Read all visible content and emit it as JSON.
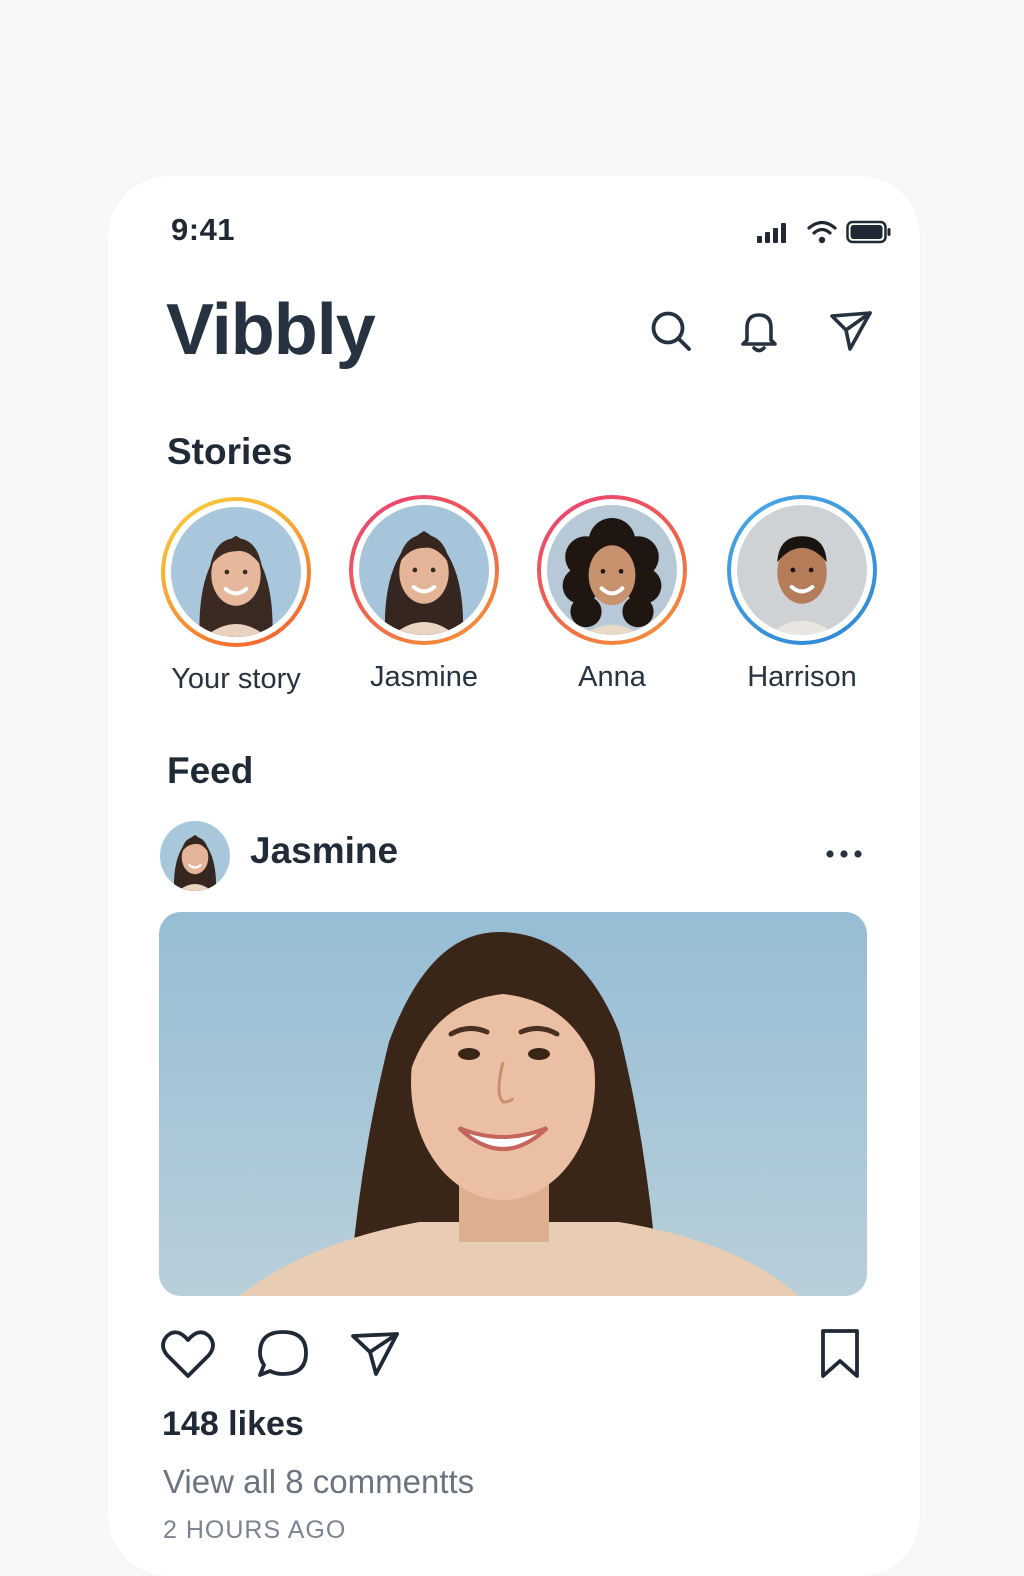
{
  "status_bar": {
    "time": "9:41",
    "signal_icon": "cellular-signal-icon",
    "wifi_icon": "wifi-icon",
    "battery_icon": "battery-icon"
  },
  "header": {
    "app_name": "Vibbly",
    "icons": [
      "search-icon",
      "bell-icon",
      "send-icon"
    ]
  },
  "stories": {
    "title": "Stories",
    "items": [
      {
        "label": "Your story",
        "ring": "gradient-orange-yellow"
      },
      {
        "label": "Jasmine",
        "ring": "gradient-pink-orange"
      },
      {
        "label": "Anna",
        "ring": "gradient-pink-orange"
      },
      {
        "label": "Harrison",
        "ring": "blue"
      }
    ]
  },
  "feed": {
    "title": "Feed",
    "post": {
      "author": "Jasmine",
      "more_icon": "more-horizontal-icon",
      "likes": "148 likes",
      "comments_link": "View all 8 commentts",
      "timestamp": "2 HOURS AGO",
      "actions": [
        "heart-icon",
        "comment-icon",
        "send-icon",
        "bookmark-icon"
      ]
    }
  },
  "colors": {
    "text": "#243040",
    "muted": "#6a7480",
    "ring_yellow": "#f7c531",
    "ring_orange": "#f57a2c",
    "ring_pink": "#e63a6e",
    "ring_blue": "#3598dc",
    "photo_sky": "#9dc2d8"
  }
}
